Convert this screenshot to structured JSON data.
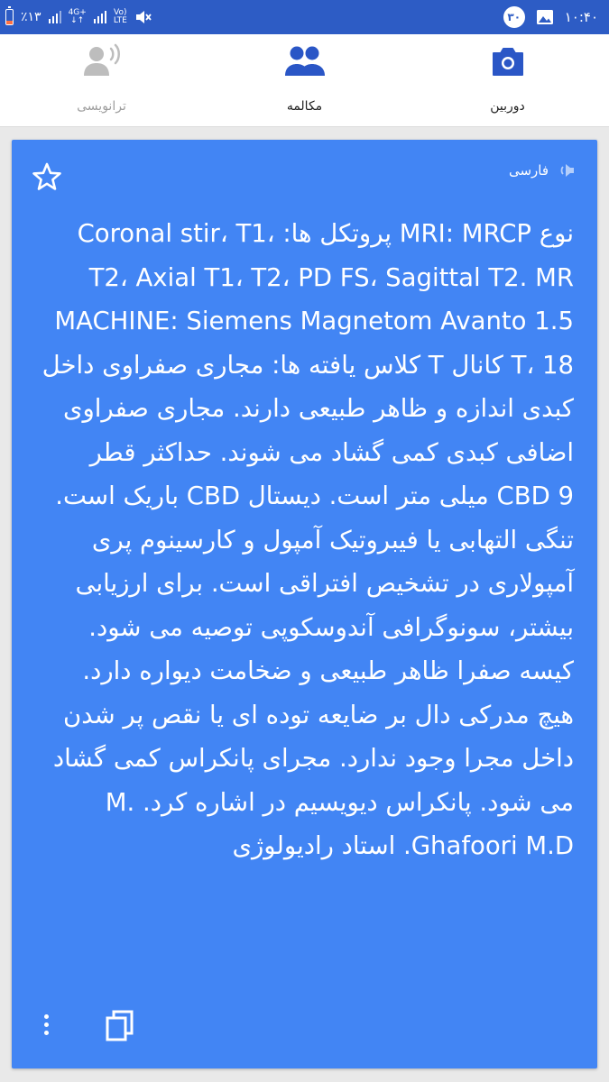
{
  "status_bar": {
    "battery_text": "٪۱۳",
    "network_type": "4G+",
    "volte_top": "Vo)",
    "volte_bottom": "LTE",
    "notification_count": "۳۰",
    "time": "۱۰:۴۰"
  },
  "tabs": [
    {
      "label": "ترانویسی",
      "icon": "transcribe-icon",
      "enabled": false
    },
    {
      "label": "مکالمه",
      "icon": "conversation-icon",
      "enabled": true
    },
    {
      "label": "دوربین",
      "icon": "camera-icon",
      "enabled": true
    }
  ],
  "card": {
    "language": "فارسی",
    "text": "نوع MRI: MRCP پروتکل ها: Coronal stir، T1، T2، Axial T1، T2، PD FS، Sagittal T2.  MR MACHINE: Siemens Magnetom Avanto 1.5 T، 18 کانال T کلاس یافته ها: مجاری صفراوی داخل کبدی اندازه و ظاهر طبیعی دارند.  مجاری صفراوی اضافی کبدی کمی گشاد می شوند.  حداکثر قطر CBD 9 میلی متر است.  دیستال CBD باریک است.  تنگی التهابی یا فیبروتیک آمپول و کارسینوم پری آمپولاری در تشخیص افتراقی است.  برای ارزیابی بیشتر، سونوگرافی آندوسکوپی توصیه می شود.  کیسه صفرا ظاهر طبیعی و ضخامت دیواره دارد.  هیچ مدرکی دال بر ضایعه توده ای یا نقص پر شدن داخل مجرا وجود ندارد.  مجرای پانکراس کمی گشاد می شود.  پانکراس دیویسیم در اشاره کرد.  M. Ghafoori M.D.  استاد رادیولوژی"
  },
  "colors": {
    "status_bar": "#2d5cc5",
    "card": "#4285f4",
    "tab_active_icon": "#2a56c6",
    "tab_disabled_icon": "#bdbdbd"
  }
}
